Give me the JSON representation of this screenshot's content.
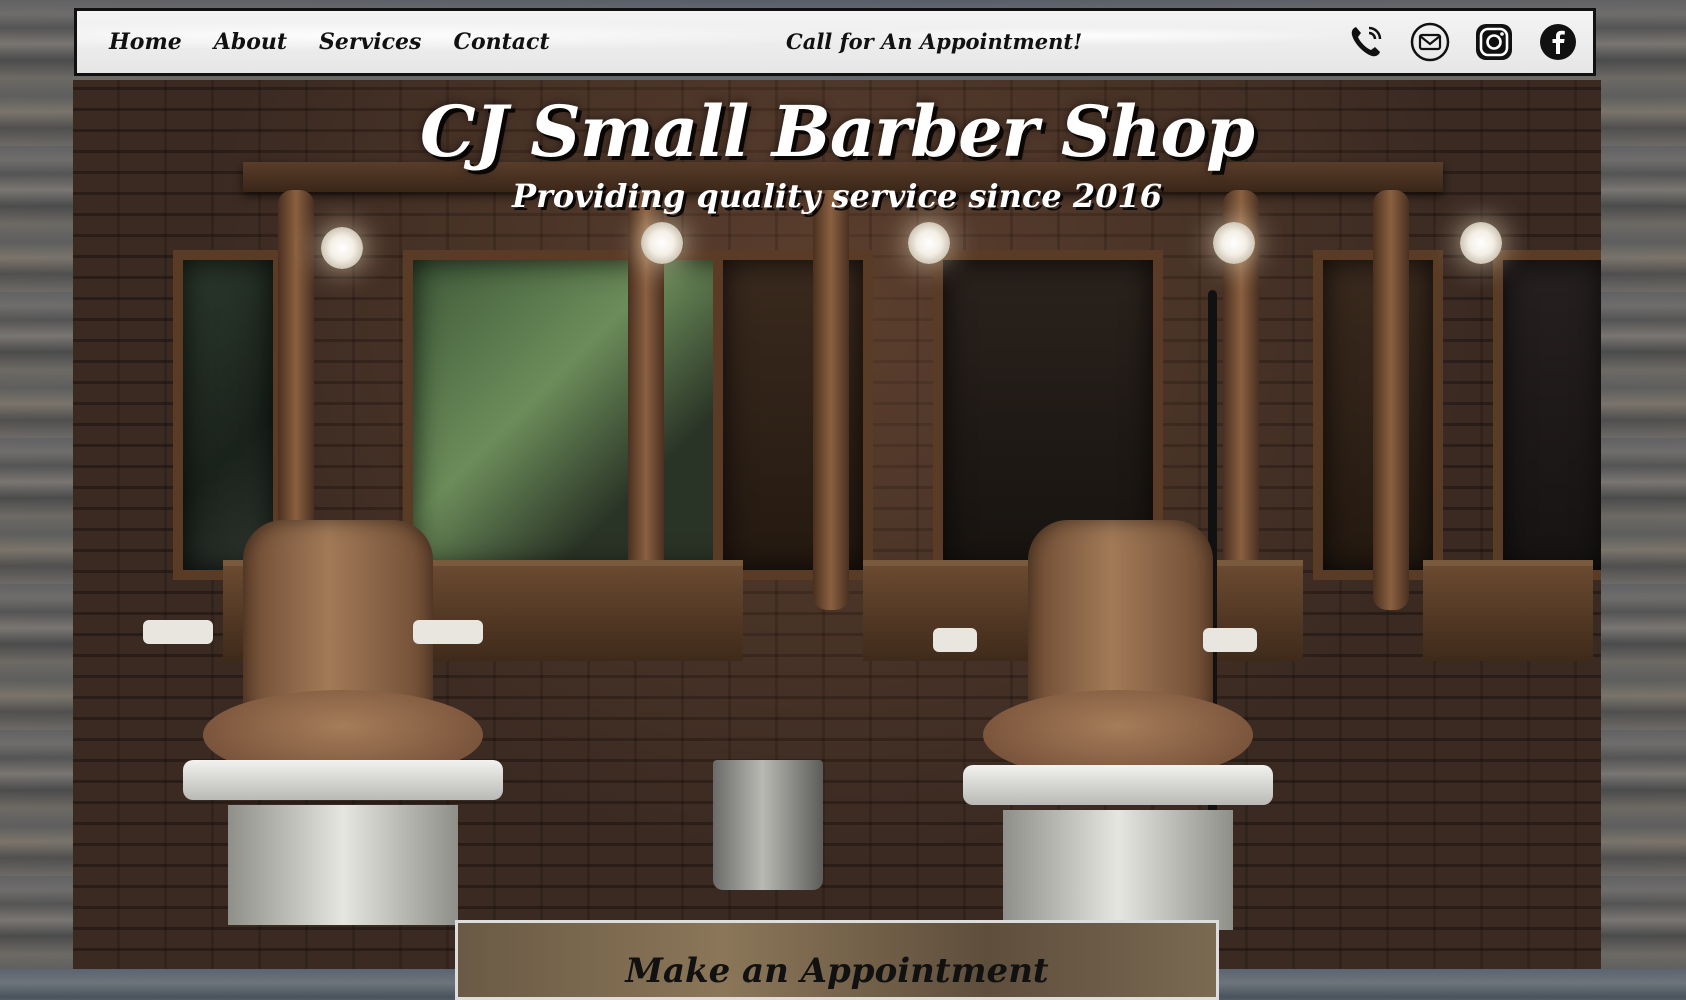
{
  "nav": {
    "links": [
      "Home",
      "About",
      "Services",
      "Contact"
    ],
    "cta": "Call for An Appointment!",
    "icons": [
      "phone-icon",
      "email-icon",
      "instagram-icon",
      "facebook-icon"
    ]
  },
  "hero": {
    "title": "CJ Small Barber Shop",
    "subtitle": "Providing quality service since 2016"
  },
  "appointment": {
    "title": "Make an Appointment"
  },
  "colors": {
    "nav_bg": "#eeeeee",
    "nav_border": "#111111",
    "hero_text": "#ffffff"
  }
}
